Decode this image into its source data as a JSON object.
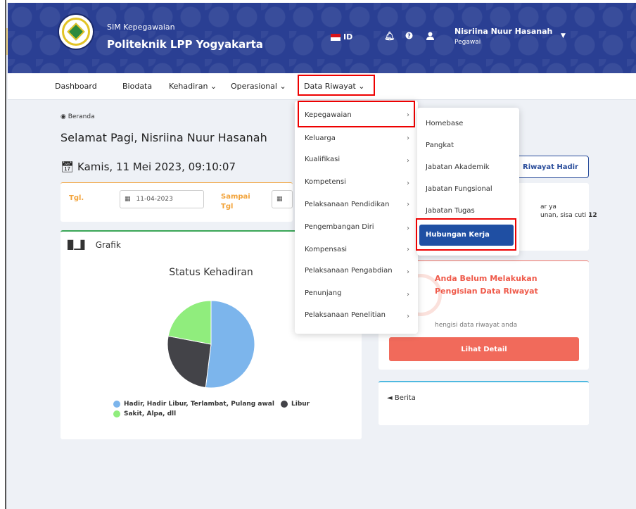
{
  "header": {
    "app_subtitle": "SIM Kepegawaian",
    "app_title": "Politeknik LPP Yogyakarta",
    "language": "ID",
    "user_name": "Nisriina Nuur Hasanah",
    "user_role": "Pegawai"
  },
  "nav": {
    "items": [
      {
        "label": "Dashboard"
      },
      {
        "label": "Biodata"
      },
      {
        "label": "Kehadiran ⌄"
      },
      {
        "label": "Operasional ⌄"
      },
      {
        "label": "Data Riwayat ⌄"
      }
    ]
  },
  "main": {
    "breadcrumb": "Beranda",
    "greeting": "Selamat Pagi, Nisriina Nuur Hasanah",
    "date": "Kamis, 11 Mei 2023, 09:10:07",
    "filter": {
      "tgl_label": "Tgl.",
      "tgl_value": "11-04-2023",
      "sampai_label": "Sampai",
      "sampai_label2": "Tgl"
    },
    "grafik_label": "Grafik",
    "riwayat_hadir_button": "Riwayat Hadir",
    "cuti_line1": "ar ya",
    "cuti_line2": "unan, sisa cuti",
    "cuti_count": "12",
    "warning_title": "Anda Belum Melakukan Pengisian Data Riwayat",
    "warning_sub": "hengisi data riwayat anda",
    "detail_button": "Lihat Detail",
    "berita_label": "Berita"
  },
  "dropdown": {
    "items": [
      {
        "label": "Kepegawaian"
      },
      {
        "label": "Keluarga"
      },
      {
        "label": "Kualifikasi"
      },
      {
        "label": "Kompetensi"
      },
      {
        "label": "Pelaksanaan Pendidikan"
      },
      {
        "label": "Pengembangan Diri"
      },
      {
        "label": "Kompensasi"
      },
      {
        "label": "Pelaksanaan Pengabdian"
      },
      {
        "label": "Penunjang"
      },
      {
        "label": "Pelaksanaan Penelitian"
      }
    ],
    "submenu": [
      {
        "label": "Homebase"
      },
      {
        "label": "Pangkat"
      },
      {
        "label": "Jabatan Akademik"
      },
      {
        "label": "Jabatan Fungsional"
      },
      {
        "label": "Jabatan Tugas"
      },
      {
        "label": "Hubungan Kerja"
      }
    ]
  },
  "chart_data": {
    "type": "pie",
    "title": "Status Kehadiran",
    "categories": [
      "Hadir, Hadir Libur, Terlambat, Pulang awal",
      "Libur",
      "Sakit, Alpa, dll"
    ],
    "values": [
      52,
      26,
      22
    ],
    "colors": [
      "#7cb5ec",
      "#434348",
      "#90ed7d"
    ]
  }
}
